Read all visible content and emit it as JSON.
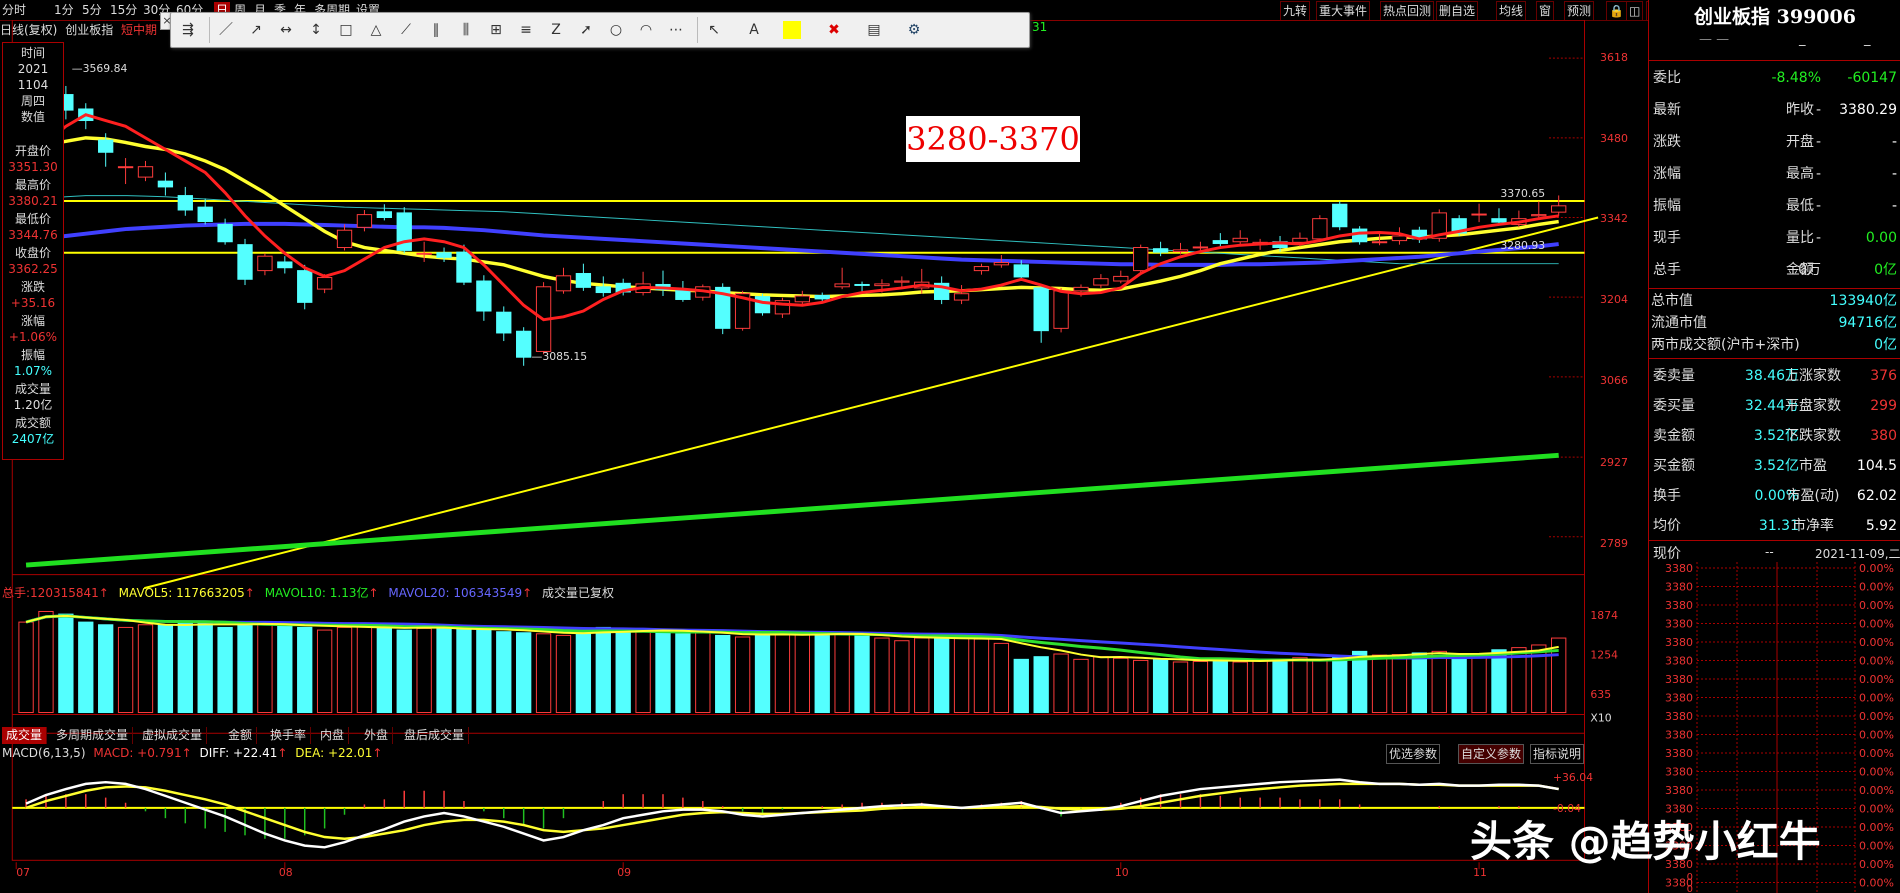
{
  "colors": {
    "up": "#ff3c3c",
    "down": "#54ffff",
    "ma5": "#ff2020",
    "ma10": "#ffff30",
    "ma20": "#4040ff",
    "ma60": "#30c0c0",
    "trend": "#ffff00",
    "support": "#20e020",
    "bg": "#000000"
  },
  "period_tabs": [
    "分时",
    "1分",
    "5分",
    "15分",
    "30分",
    "60分",
    "日",
    "周",
    "月",
    "季",
    "年",
    "多周期",
    "设置"
  ],
  "active_period": "日",
  "sub_header": {
    "mode": "日线(复权)",
    "name": "创业板指",
    "extra": "短中期"
  },
  "top_right_buttons": [
    "九转",
    "重大事件",
    "热点回测",
    "删自选",
    "均线",
    "窗",
    "预测",
    "lock-icon",
    "restore-icon",
    "prev-icon"
  ],
  "toolbar_badge": "31",
  "toolbar_tools": [
    "cursor-icon",
    "line-icon",
    "ray-icon",
    "segment-icon",
    "vertical-line-icon",
    "rectangle-icon",
    "triangle-icon",
    "fan-icon",
    "parallel-icon",
    "bar-icon",
    "channel-icon",
    "fib-icon",
    "zigzag-icon",
    "arrow-icon",
    "ellipse-icon",
    "arc-icon",
    "more-icon",
    "select-icon",
    "text-icon",
    "color-icon",
    "delete-icon",
    "save-icon",
    "settings-icon"
  ],
  "info_panel": {
    "time_label": "时间",
    "year": "2021",
    "date": "1104",
    "weekday_label": "周四",
    "value_label": "数值",
    "open_label": "开盘价",
    "open": "3351.30",
    "high_label": "最高价",
    "high": "3380.21",
    "low_label": "最低价",
    "low": "3344.76",
    "close_label": "收盘价",
    "close": "3362.25",
    "change_label": "涨跌",
    "change": "+35.16",
    "pct_label": "涨幅",
    "pct": "+1.06%",
    "amp_label": "振幅",
    "amp": "1.07%",
    "vol_label": "成交量",
    "vol": "1.20亿",
    "amt_label": "成交额",
    "amt": "2407亿"
  },
  "range_label": "3280-3370",
  "annotations": {
    "peak": "3569.84",
    "trough": "3085.15",
    "upper_line": "3370.65",
    "lower_line": "3280.93"
  },
  "price_axis": [
    "3618",
    "3480",
    "3342",
    "3204",
    "3066",
    "2927",
    "2789"
  ],
  "volume_header": {
    "total_label": "总手:",
    "total": "120315841",
    "mavol5": "MAVOL5: 117663205",
    "mavol10": "MAVOL10: 1.13亿",
    "mavol20": "MAVOL20: 106343549",
    "note": "成交量已复权"
  },
  "volume_axis": [
    "1874",
    "1254",
    "635",
    "X10"
  ],
  "indicator_tabs": [
    "成交量",
    "多周期成交量",
    "虚拟成交量",
    "金额",
    "换手率",
    "内盘",
    "外盘",
    "盘后成交量"
  ],
  "macd_header": {
    "name": "MACD(6,13,5)",
    "macd": "MACD: +0.791",
    "diff": "DIFF: +22.41",
    "dea": "DEA: +22.01"
  },
  "macd_buttons": [
    "优选参数",
    "自定义参数",
    "指标说明"
  ],
  "macd_axis": [
    "+36.04",
    "-0.04"
  ],
  "date_axis": [
    "07",
    "08",
    "09",
    "10",
    "11"
  ],
  "right_panel": {
    "title": "创业板指 399006",
    "rows": [
      {
        "l": "委比",
        "v1": "-8.48%",
        "l2": "",
        "v2": "-60147"
      },
      {
        "l": "最新",
        "v1": "-",
        "l2": "昨收",
        "v2": "3380.29"
      },
      {
        "l": "涨跌",
        "v1": "-",
        "l2": "开盘",
        "v2": "-"
      },
      {
        "l": "涨幅",
        "v1": "-",
        "l2": "最高",
        "v2": "-"
      },
      {
        "l": "振幅",
        "v1": "-",
        "l2": "最低",
        "v2": "-"
      },
      {
        "l": "现手",
        "v1": "-",
        "l2": "量比",
        "v2": "0.00"
      },
      {
        "l": "总手",
        "v1": "0万",
        "l2": "金额",
        "v2": "0亿"
      }
    ],
    "market_rows": [
      {
        "l": "总市值",
        "v": "133940亿"
      },
      {
        "l": "流通市值",
        "v": "94716亿"
      },
      {
        "l": "两市成交额(沪市+深市)",
        "v": "0亿"
      }
    ],
    "stats": [
      {
        "l": "委卖量",
        "v1": "38.46万",
        "l2": "上涨家数",
        "v2": "376"
      },
      {
        "l": "委买量",
        "v1": "32.44万",
        "l2": "平盘家数",
        "v2": "299"
      },
      {
        "l": "卖金额",
        "v1": "3.52亿",
        "l2": "下跌家数",
        "v2": "380"
      },
      {
        "l": "买金额",
        "v1": "3.52亿",
        "l2": "市盈",
        "v2": "104.5"
      },
      {
        "l": "换手",
        "v1": "0.00%",
        "l2": "市盈(动)",
        "v2": "62.02"
      },
      {
        "l": "均价",
        "v1": "31.31",
        "l2": "市净率",
        "v2": "5.92"
      }
    ],
    "current_label": "现价",
    "current_dash": "--",
    "current_date": "2021-11-09,二",
    "price_ticks": [
      "3380",
      "3380",
      "3380",
      "3380",
      "3380",
      "3380",
      "3380",
      "3380",
      "3380",
      "3380",
      "3380",
      "3380",
      "3380",
      "3380",
      "3380",
      "3380",
      "3380",
      "3380"
    ],
    "pct_ticks": [
      "0.00%",
      "0.00%",
      "0.00%",
      "0.00%",
      "0.00%",
      "0.00%",
      "0.00%",
      "0.00%",
      "0.00%",
      "0.00%",
      "0.00%",
      "0.00%",
      "0.00%",
      "0.00%",
      "0.00%",
      "0.00%",
      "0.00%",
      "0.00%"
    ],
    "bottom_ticks": [
      "0",
      "0"
    ]
  },
  "watermark": "头条 @趋势小红牛",
  "chart_data": {
    "type": "candlestick",
    "price_range": [
      2720,
      3650
    ],
    "candles": [
      {
        "o": 3402,
        "c": 3455,
        "h": 3476,
        "l": 3395
      },
      {
        "o": 3520,
        "c": 3590,
        "h": 3595,
        "l": 3510
      },
      {
        "o": 3555,
        "c": 3528,
        "h": 3569.84,
        "l": 3512
      },
      {
        "o": 3530,
        "c": 3510,
        "h": 3540,
        "l": 3495
      },
      {
        "o": 3476,
        "c": 3455,
        "h": 3488,
        "l": 3430
      },
      {
        "o": 3430,
        "c": 3430,
        "h": 3445,
        "l": 3400
      },
      {
        "o": 3412,
        "c": 3430,
        "h": 3440,
        "l": 3405
      },
      {
        "o": 3405,
        "c": 3395,
        "h": 3420,
        "l": 3380
      },
      {
        "o": 3380,
        "c": 3355,
        "h": 3395,
        "l": 3345
      },
      {
        "o": 3360,
        "c": 3335,
        "h": 3375,
        "l": 3330
      },
      {
        "o": 3330,
        "c": 3300,
        "h": 3340,
        "l": 3295
      },
      {
        "o": 3295,
        "c": 3235,
        "h": 3305,
        "l": 3225
      },
      {
        "o": 3250,
        "c": 3275,
        "h": 3280,
        "l": 3242
      },
      {
        "o": 3265,
        "c": 3255,
        "h": 3275,
        "l": 3245
      },
      {
        "o": 3250,
        "c": 3195,
        "h": 3260,
        "l": 3183
      },
      {
        "o": 3218,
        "c": 3238,
        "h": 3244,
        "l": 3211
      },
      {
        "o": 3290,
        "c": 3320,
        "h": 3330,
        "l": 3285
      },
      {
        "o": 3325,
        "c": 3347,
        "h": 3355,
        "l": 3318
      },
      {
        "o": 3352,
        "c": 3342,
        "h": 3365,
        "l": 3337
      },
      {
        "o": 3350,
        "c": 3285,
        "h": 3360,
        "l": 3280
      },
      {
        "o": 3280,
        "c": 3280,
        "h": 3300,
        "l": 3265
      },
      {
        "o": 3281,
        "c": 3273,
        "h": 3290,
        "l": 3265
      },
      {
        "o": 3282,
        "c": 3230,
        "h": 3295,
        "l": 3225
      },
      {
        "o": 3232,
        "c": 3180,
        "h": 3242,
        "l": 3163
      },
      {
        "o": 3178,
        "c": 3142,
        "h": 3188,
        "l": 3128
      },
      {
        "o": 3145,
        "c": 3100,
        "h": 3152,
        "l": 3085.15
      },
      {
        "o": 3110,
        "c": 3222,
        "h": 3230,
        "l": 3105
      },
      {
        "o": 3215,
        "c": 3241,
        "h": 3255,
        "l": 3210
      },
      {
        "o": 3245,
        "c": 3221,
        "h": 3262,
        "l": 3215
      },
      {
        "o": 3222,
        "c": 3212,
        "h": 3240,
        "l": 3205
      },
      {
        "o": 3228,
        "c": 3213,
        "h": 3236,
        "l": 3207
      },
      {
        "o": 3212,
        "c": 3227,
        "h": 3248,
        "l": 3207
      },
      {
        "o": 3226,
        "c": 3217,
        "h": 3250,
        "l": 3206
      },
      {
        "o": 3216,
        "c": 3200,
        "h": 3232,
        "l": 3196
      },
      {
        "o": 3204,
        "c": 3222,
        "h": 3226,
        "l": 3198
      },
      {
        "o": 3221,
        "c": 3150,
        "h": 3228,
        "l": 3140
      },
      {
        "o": 3150,
        "c": 3210,
        "h": 3215,
        "l": 3146
      },
      {
        "o": 3205,
        "c": 3177,
        "h": 3210,
        "l": 3172
      },
      {
        "o": 3175,
        "c": 3198,
        "h": 3203,
        "l": 3168
      },
      {
        "o": 3196,
        "c": 3206,
        "h": 3215,
        "l": 3190
      },
      {
        "o": 3207,
        "c": 3201,
        "h": 3212,
        "l": 3195
      },
      {
        "o": 3222,
        "c": 3227,
        "h": 3255,
        "l": 3218
      },
      {
        "o": 3226,
        "c": 3225,
        "h": 3231,
        "l": 3210
      },
      {
        "o": 3224,
        "c": 3227,
        "h": 3235,
        "l": 3212
      },
      {
        "o": 3230,
        "c": 3232,
        "h": 3240,
        "l": 3220
      },
      {
        "o": 3220,
        "c": 3230,
        "h": 3253,
        "l": 3210
      },
      {
        "o": 3228,
        "c": 3200,
        "h": 3240,
        "l": 3192
      },
      {
        "o": 3199,
        "c": 3210,
        "h": 3225,
        "l": 3192
      },
      {
        "o": 3250,
        "c": 3257,
        "h": 3262,
        "l": 3243
      },
      {
        "o": 3260,
        "c": 3264,
        "h": 3277,
        "l": 3255
      },
      {
        "o": 3260,
        "c": 3239,
        "h": 3268,
        "l": 3232
      },
      {
        "o": 3220,
        "c": 3146,
        "h": 3223,
        "l": 3125
      },
      {
        "o": 3150,
        "c": 3215,
        "h": 3220,
        "l": 3143
      },
      {
        "o": 3215,
        "c": 3221,
        "h": 3226,
        "l": 3205
      },
      {
        "o": 3225,
        "c": 3236,
        "h": 3244,
        "l": 3220
      },
      {
        "o": 3232,
        "c": 3240,
        "h": 3250,
        "l": 3228
      },
      {
        "o": 3250,
        "c": 3290,
        "h": 3295,
        "l": 3245
      },
      {
        "o": 3288,
        "c": 3282,
        "h": 3300,
        "l": 3275
      },
      {
        "o": 3283,
        "c": 3286,
        "h": 3298,
        "l": 3278
      },
      {
        "o": 3290,
        "c": 3291,
        "h": 3300,
        "l": 3285
      },
      {
        "o": 3302,
        "c": 3297,
        "h": 3315,
        "l": 3290
      },
      {
        "o": 3300,
        "c": 3306,
        "h": 3320,
        "l": 3296
      },
      {
        "o": 3295,
        "c": 3299,
        "h": 3305,
        "l": 3286
      },
      {
        "o": 3300,
        "c": 3290,
        "h": 3310,
        "l": 3283
      },
      {
        "o": 3299,
        "c": 3306,
        "h": 3316,
        "l": 3292
      },
      {
        "o": 3305,
        "c": 3340,
        "h": 3346,
        "l": 3300
      },
      {
        "o": 3365,
        "c": 3326,
        "h": 3370,
        "l": 3320
      },
      {
        "o": 3322,
        "c": 3300,
        "h": 3327,
        "l": 3295
      },
      {
        "o": 3300,
        "c": 3300,
        "h": 3316,
        "l": 3294
      },
      {
        "o": 3302,
        "c": 3310,
        "h": 3325,
        "l": 3295
      },
      {
        "o": 3320,
        "c": 3305,
        "h": 3326,
        "l": 3298
      },
      {
        "o": 3306,
        "c": 3350,
        "h": 3356,
        "l": 3300
      },
      {
        "o": 3340,
        "c": 3315,
        "h": 3346,
        "l": 3310
      },
      {
        "o": 3348,
        "c": 3348,
        "h": 3366,
        "l": 3334
      },
      {
        "o": 3340,
        "c": 3334,
        "h": 3358,
        "l": 3328
      },
      {
        "o": 3330,
        "c": 3340,
        "h": 3354,
        "l": 3325
      },
      {
        "o": 3345,
        "c": 3347,
        "h": 3370,
        "l": 3338
      },
      {
        "o": 3351.3,
        "c": 3362.25,
        "h": 3380.21,
        "l": 3344.76
      }
    ],
    "ma5": [
      3430,
      3470,
      3500,
      3520,
      3510,
      3500,
      3480,
      3460,
      3440,
      3420,
      3385,
      3345,
      3310,
      3280,
      3255,
      3240,
      3250,
      3270,
      3290,
      3300,
      3305,
      3300,
      3290,
      3260,
      3225,
      3190,
      3165,
      3170,
      3180,
      3200,
      3215,
      3221,
      3220,
      3218,
      3215,
      3210,
      3203,
      3195,
      3192,
      3190,
      3195,
      3205,
      3212,
      3216,
      3220,
      3225,
      3222,
      3215,
      3218,
      3225,
      3235,
      3225,
      3214,
      3210,
      3212,
      3220,
      3245,
      3262,
      3274,
      3283,
      3290,
      3294,
      3296,
      3298,
      3296,
      3302,
      3310,
      3315,
      3316,
      3314,
      3305,
      3312,
      3318,
      3325,
      3330,
      3334,
      3340,
      3345
    ],
    "ma10": [
      3460,
      3468,
      3474,
      3480,
      3478,
      3472,
      3465,
      3460,
      3452,
      3440,
      3425,
      3405,
      3385,
      3362,
      3340,
      3318,
      3300,
      3290,
      3285,
      3280,
      3275,
      3272,
      3270,
      3265,
      3260,
      3250,
      3240,
      3233,
      3228,
      3225,
      3222,
      3220,
      3218,
      3216,
      3215,
      3212,
      3210,
      3208,
      3207,
      3206,
      3205,
      3206,
      3207,
      3208,
      3210,
      3213,
      3214,
      3215,
      3217,
      3219,
      3221,
      3220,
      3219,
      3217,
      3216,
      3218,
      3225,
      3232,
      3240,
      3250,
      3262,
      3270,
      3278,
      3285,
      3290,
      3295,
      3300,
      3303,
      3306,
      3308,
      3308,
      3310,
      3312,
      3316,
      3320,
      3324,
      3330,
      3335
    ],
    "ma20": [
      3300,
      3305,
      3310,
      3314,
      3318,
      3322,
      3324,
      3326,
      3328,
      3329,
      3330,
      3331,
      3331,
      3331,
      3330,
      3329,
      3328,
      3327,
      3326,
      3325,
      3325,
      3324,
      3322,
      3320,
      3317,
      3314,
      3311,
      3309,
      3307,
      3305,
      3303,
      3301,
      3299,
      3297,
      3295,
      3293,
      3291,
      3289,
      3287,
      3285,
      3283,
      3281,
      3279,
      3277,
      3275,
      3273,
      3271,
      3269,
      3268,
      3267,
      3266,
      3265,
      3264,
      3263,
      3262,
      3261,
      3261,
      3260,
      3260,
      3260,
      3260,
      3261,
      3261,
      3262,
      3263,
      3264,
      3266,
      3268,
      3270,
      3272,
      3274,
      3277,
      3280,
      3283,
      3286,
      3289,
      3292,
      3296
    ],
    "ma60": [
      3370,
      3375,
      3378,
      3380,
      3380,
      3380,
      3379,
      3378,
      3376,
      3374,
      3372,
      3370,
      3368,
      3366,
      3364,
      3362,
      3360,
      3359,
      3358,
      3357,
      3356,
      3355,
      3354,
      3353,
      3352,
      3350,
      3348,
      3346,
      3344,
      3342,
      3340,
      3338,
      3336,
      3334,
      3332,
      3330,
      3328,
      3326,
      3324,
      3322,
      3320,
      3318,
      3316,
      3314,
      3312,
      3310,
      3308,
      3306,
      3304,
      3302,
      3300,
      3298,
      3296,
      3294,
      3292,
      3290,
      3288,
      3286,
      3284,
      3282,
      3280,
      3278,
      3276,
      3274,
      3272,
      3270,
      3268,
      3266,
      3264,
      3262,
      3262,
      3262,
      3262,
      3262,
      3262,
      3262,
      3262,
      3262
    ],
    "h_lines": [
      3370.65,
      3280.93
    ],
    "trend_line": {
      "from": [
        0,
        2700
      ],
      "to": [
        77,
        3342
      ]
    },
    "support_line": {
      "from": [
        0,
        2740
      ],
      "to": [
        77,
        2930
      ]
    },
    "volume": [
      1700,
      1900,
      1850,
      1700,
      1650,
      1600,
      1650,
      1650,
      1680,
      1700,
      1600,
      1650,
      1700,
      1650,
      1600,
      1550,
      1600,
      1650,
      1600,
      1550,
      1580,
      1600,
      1560,
      1550,
      1520,
      1500,
      1480,
      1450,
      1500,
      1600,
      1550,
      1560,
      1500,
      1480,
      1520,
      1450,
      1420,
      1460,
      1500,
      1480,
      1470,
      1480,
      1450,
      1400,
      1350,
      1400,
      1430,
      1400,
      1380,
      1300,
      1000,
      1050,
      1100,
      1000,
      1050,
      1020,
      980,
      1000,
      950,
      960,
      1000,
      950,
      980,
      1000,
      1030,
      1000,
      1050,
      1150,
      1080,
      1090,
      1120,
      1150,
      1060,
      1100,
      1180,
      1220,
      1270,
      1400
    ],
    "volume_max": 2000,
    "diff": [
      5,
      15,
      22,
      28,
      30,
      28,
      22,
      14,
      6,
      -2,
      -10,
      -20,
      -30,
      -38,
      -44,
      -46,
      -40,
      -32,
      -25,
      -16,
      -10,
      -6,
      -10,
      -16,
      -22,
      -30,
      -38,
      -34,
      -26,
      -20,
      -12,
      -8,
      -4,
      -2,
      -2,
      -4,
      -8,
      -10,
      -8,
      -6,
      -4,
      -2,
      0,
      2,
      3,
      4,
      2,
      0,
      2,
      4,
      6,
      0,
      -6,
      -4,
      -2,
      2,
      8,
      14,
      18,
      22,
      24,
      26,
      28,
      30,
      31,
      32,
      33,
      30,
      28,
      28,
      27,
      28,
      26,
      26,
      27,
      27,
      26,
      22
    ],
    "dea": [
      0,
      8,
      14,
      20,
      24,
      25,
      24,
      20,
      15,
      10,
      4,
      -4,
      -12,
      -20,
      -28,
      -34,
      -36,
      -34,
      -30,
      -26,
      -20,
      -16,
      -14,
      -14,
      -16,
      -20,
      -26,
      -28,
      -26,
      -24,
      -20,
      -16,
      -12,
      -8,
      -6,
      -5,
      -6,
      -7,
      -7,
      -6,
      -5,
      -4,
      -3,
      -1,
      0,
      1,
      1,
      0,
      0,
      1,
      2,
      1,
      -1,
      -2,
      -2,
      -1,
      2,
      6,
      10,
      14,
      17,
      20,
      22,
      24,
      26,
      27,
      28,
      28,
      28,
      28,
      27,
      27,
      26,
      26,
      26,
      26,
      26,
      22
    ],
    "macd_range": [
      -60,
      40
    ]
  }
}
